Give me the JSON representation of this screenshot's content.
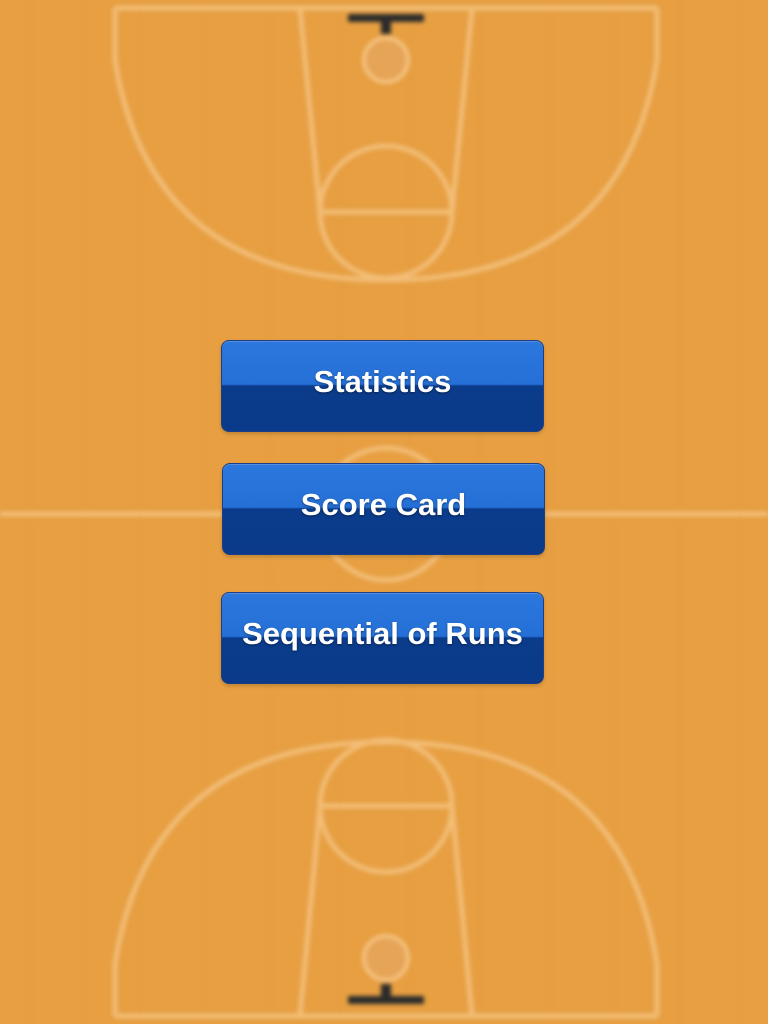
{
  "background": {
    "description_color": "#e79f42",
    "line_color": "#f5c381",
    "rim_color": "#2b2b2b"
  },
  "menu": {
    "accent_top": "#2c77dd",
    "accent_bottom": "#0a3a89",
    "buttons": [
      {
        "id": "statistics",
        "label": "Statistics"
      },
      {
        "id": "score-card",
        "label": "Score Card"
      },
      {
        "id": "sequential-of-runs",
        "label": "Sequential of Runs"
      }
    ]
  }
}
